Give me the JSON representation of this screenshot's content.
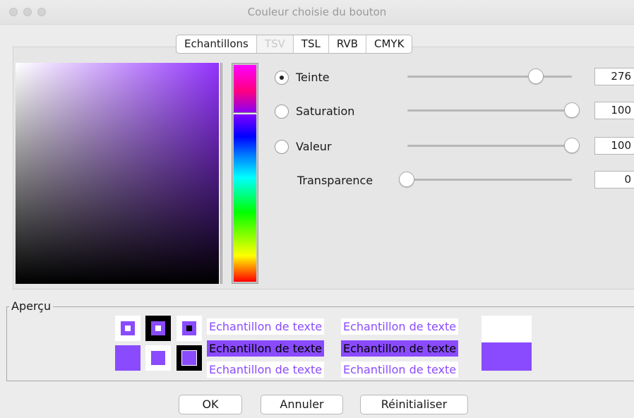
{
  "window": {
    "title": "Couleur choisie du bouton"
  },
  "tabs": [
    {
      "label": "Echantillons",
      "selected": false
    },
    {
      "label": "TSV",
      "selected": true
    },
    {
      "label": "TSL",
      "selected": false
    },
    {
      "label": "RVB",
      "selected": false
    },
    {
      "label": "CMYK",
      "selected": false
    }
  ],
  "controls": {
    "teinte": {
      "label": "Teinte",
      "value": "276",
      "checked": true
    },
    "saturation": {
      "label": "Saturation",
      "value": "100",
      "checked": false
    },
    "valeur": {
      "label": "Valeur",
      "value": "100",
      "checked": false
    },
    "transparence": {
      "label": "Transparence",
      "value": "0"
    }
  },
  "preview": {
    "legend": "Aperçu",
    "sample_text": "Echantillon de texte",
    "selected_color": "#8a4bff"
  },
  "buttons": {
    "ok": "OK",
    "cancel": "Annuler",
    "reset": "Réinitialiser"
  }
}
